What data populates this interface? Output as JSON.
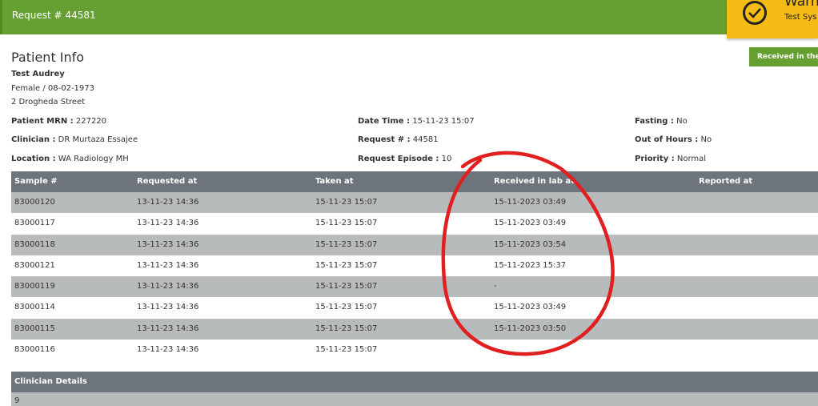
{
  "header": {
    "title": "Request # 44581"
  },
  "toast": {
    "title": "Warni",
    "text": "Test Sys",
    "icon": "check-circle-icon",
    "color": "#f4bc14"
  },
  "status_button": {
    "label": "Received in the la"
  },
  "page_title": "Patient Info",
  "patient": {
    "name": "Test Audrey",
    "sex_dob": "Female / 08-02-1973",
    "address": "2 Drogheda Street"
  },
  "fields": {
    "mrn": {
      "label": "Patient MRN :",
      "value": " 227220"
    },
    "clinician": {
      "label": "Clinician :",
      "value": " DR Murtaza Essajee"
    },
    "location": {
      "label": "Location :",
      "value": " WA Radiology MH"
    },
    "datetime": {
      "label": "Date Time :",
      "value": " 15-11-23 15:07"
    },
    "request": {
      "label": "Request # :",
      "value": " 44581"
    },
    "episode": {
      "label": "Request Episode :",
      "value": " 10"
    },
    "fasting": {
      "label": "Fasting :",
      "value": " No"
    },
    "out_of_hours": {
      "label": "Out of Hours :",
      "value": " No"
    },
    "priority": {
      "label": "Priority :",
      "value": " Normal"
    }
  },
  "table": {
    "headers": [
      "Sample #",
      "Requested at",
      "Taken at",
      "Received in lab at",
      "Reported at"
    ],
    "rows": [
      [
        "83000120",
        "13-11-23 14:36",
        "15-11-23 15:07",
        "15-11-2023 03:49",
        ""
      ],
      [
        "83000117",
        "13-11-23 14:36",
        "15-11-23 15:07",
        "15-11-2023 03:49",
        ""
      ],
      [
        "83000118",
        "13-11-23 14:36",
        "15-11-23 15:07",
        "15-11-2023 03:54",
        ""
      ],
      [
        "83000121",
        "13-11-23 14:36",
        "15-11-23 15:07",
        "15-11-2023 15:37",
        ""
      ],
      [
        "83000119",
        "13-11-23 14:36",
        "15-11-23 15:07",
        "-",
        ""
      ],
      [
        "83000114",
        "13-11-23 14:36",
        "15-11-23 15:07",
        "15-11-2023 03:49",
        ""
      ],
      [
        "83000115",
        "13-11-23 14:36",
        "15-11-23 15:07",
        "15-11-2023 03:50",
        ""
      ],
      [
        "83000116",
        "13-11-23 14:36",
        "15-11-23 15:07",
        "",
        ""
      ]
    ]
  },
  "clinician_details": {
    "heading": "Clinician Details",
    "value": "9"
  },
  "colors": {
    "accent": "#66a033",
    "table_header": "#6d747b",
    "row_alt": "#b7bbbc",
    "annotation": "#e02020"
  }
}
